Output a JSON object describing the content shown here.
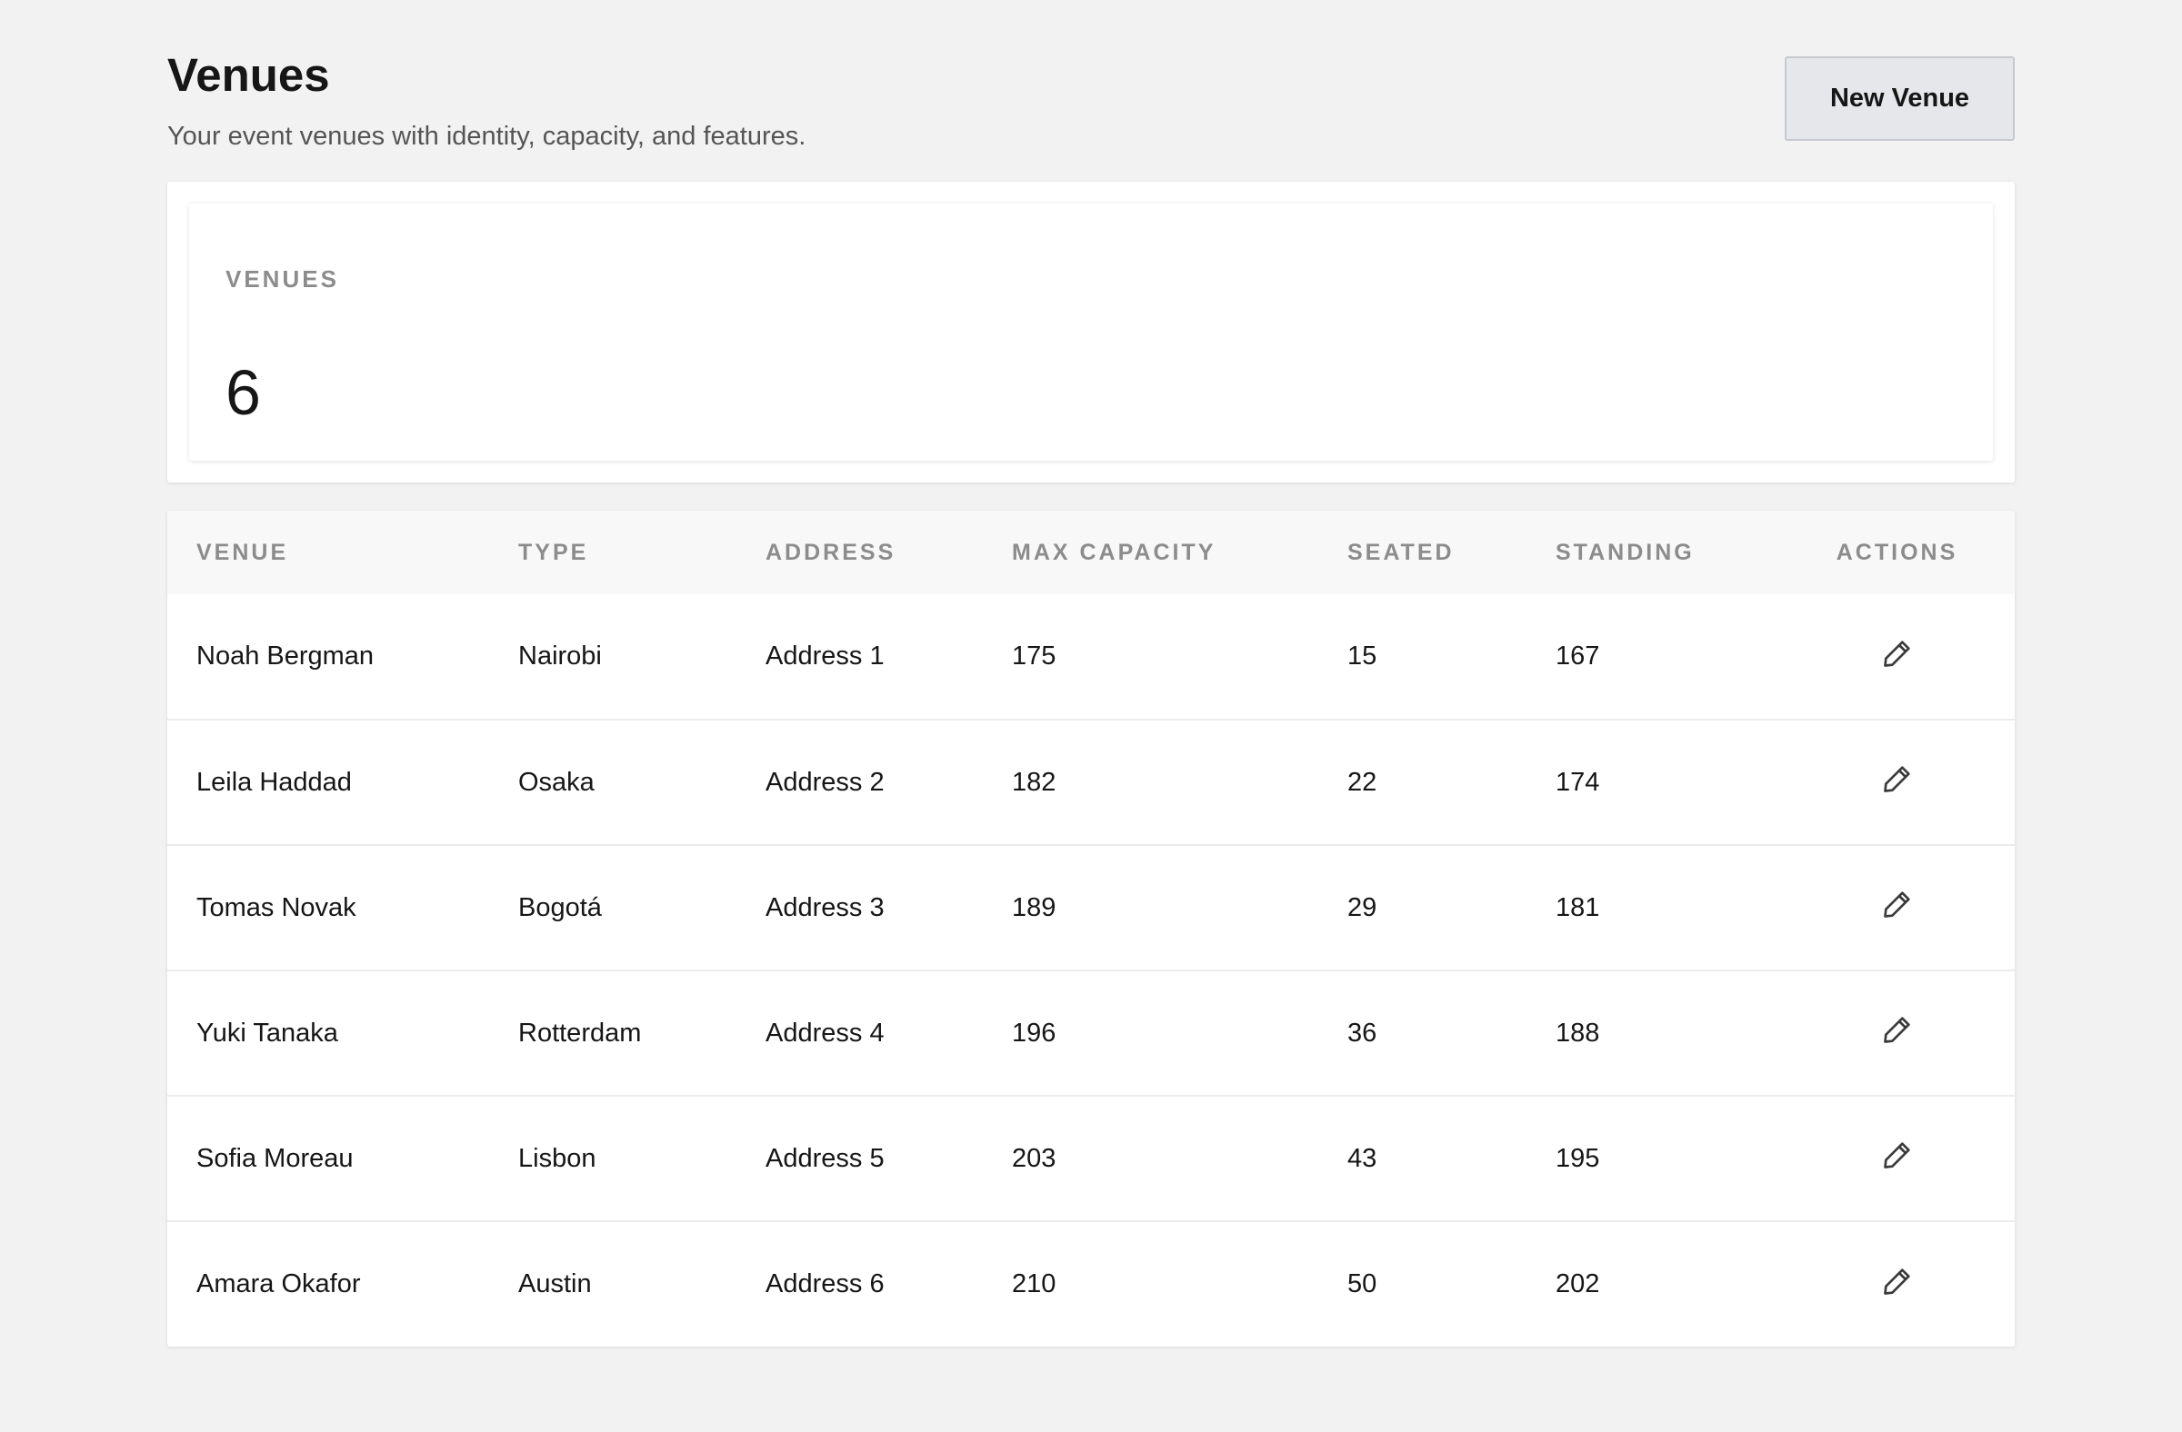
{
  "header": {
    "title": "Venues",
    "subtitle": "Your event venues with identity, capacity, and features.",
    "new_button_label": "New Venue"
  },
  "stats": {
    "label": "VENUES",
    "value": "6"
  },
  "table": {
    "columns": [
      "VENUE",
      "TYPE",
      "ADDRESS",
      "MAX CAPACITY",
      "SEATED",
      "STANDING",
      "ACTIONS"
    ],
    "rows": [
      {
        "venue": "Noah Bergman",
        "type": "Nairobi",
        "address": "Address 1",
        "max_capacity": "175",
        "seated": "15",
        "standing": "167"
      },
      {
        "venue": "Leila Haddad",
        "type": "Osaka",
        "address": "Address 2",
        "max_capacity": "182",
        "seated": "22",
        "standing": "174"
      },
      {
        "venue": "Tomas Novak",
        "type": "Bogotá",
        "address": "Address 3",
        "max_capacity": "189",
        "seated": "29",
        "standing": "181"
      },
      {
        "venue": "Yuki Tanaka",
        "type": "Rotterdam",
        "address": "Address 4",
        "max_capacity": "196",
        "seated": "36",
        "standing": "188"
      },
      {
        "venue": "Sofia Moreau",
        "type": "Lisbon",
        "address": "Address 5",
        "max_capacity": "203",
        "seated": "43",
        "standing": "195"
      },
      {
        "venue": "Amara Okafor",
        "type": "Austin",
        "address": "Address 6",
        "max_capacity": "210",
        "seated": "50",
        "standing": "202"
      }
    ],
    "row_action_icon": "pencil-edit-icon"
  }
}
